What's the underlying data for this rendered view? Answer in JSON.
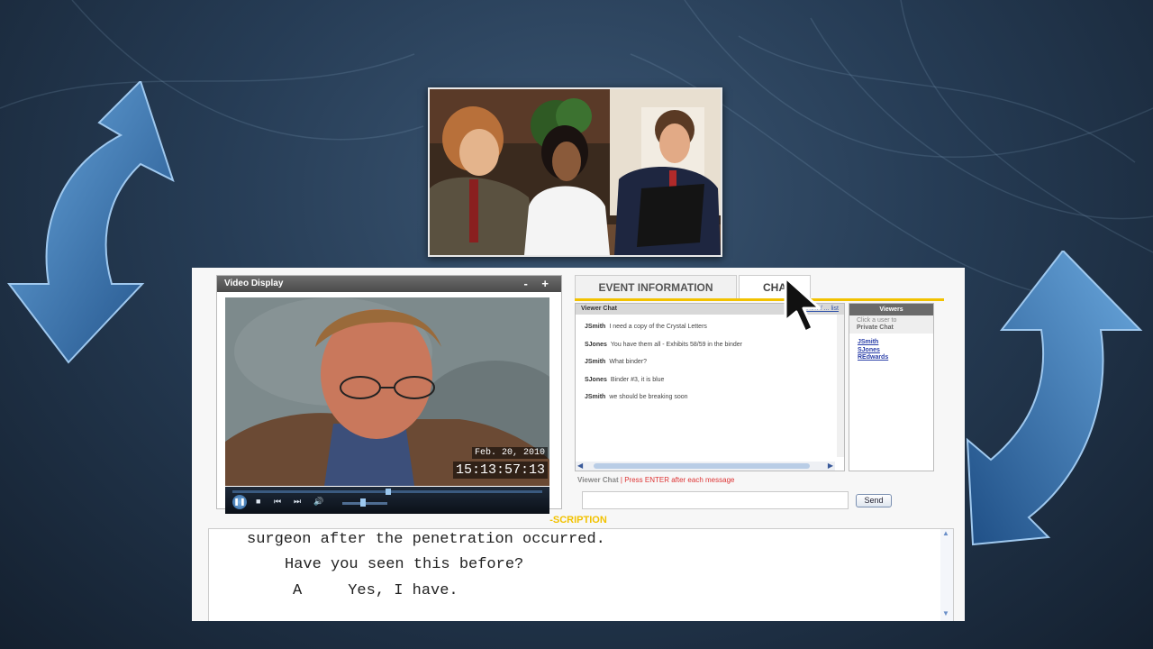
{
  "video": {
    "title": "Video Display",
    "controls": "- +",
    "date": "Feb. 20, 2010",
    "time": "15:13:57:13"
  },
  "tabs": {
    "event_info": "EVENT INFORMATION",
    "chat": "CHA"
  },
  "chat": {
    "header": "Viewer Chat",
    "header_links": "View / ... list",
    "messages": [
      {
        "user": "JSmith",
        "text": "I need a copy of the Crystal Letters"
      },
      {
        "user": "SJones",
        "text": "You have them all - Exhibits 58/59 in the binder"
      },
      {
        "user": "JSmith",
        "text": "What binder?"
      },
      {
        "user": "SJones",
        "text": "Binder #3, it is blue"
      },
      {
        "user": "JSmith",
        "text": "we should be breaking soon"
      }
    ],
    "input_label": "Viewer Chat",
    "input_hint": "| Press ENTER after each message",
    "input_value": "",
    "send_label": "Send"
  },
  "viewers": {
    "header": "Viewers",
    "note_1": "Click a user to",
    "note_2": "Private Chat",
    "list": [
      "JSmith",
      "SJones",
      "REdwards"
    ]
  },
  "transcript": {
    "title": "-SCRIPTION",
    "lines": [
      "surgeon after the penetration occurred.",
      "Have you seen this before?",
      "A     Yes, I have."
    ]
  },
  "colors": {
    "accent_yellow": "#f2c200",
    "link_blue": "#2a3ea8",
    "background": "#263c55",
    "arrow_blue": "#3f7fc0"
  },
  "icons": [
    "play-pause-icon",
    "stop-icon",
    "previous-icon",
    "next-icon",
    "volume-icon",
    "mouse-cursor-icon",
    "curved-arrow-icon"
  ]
}
